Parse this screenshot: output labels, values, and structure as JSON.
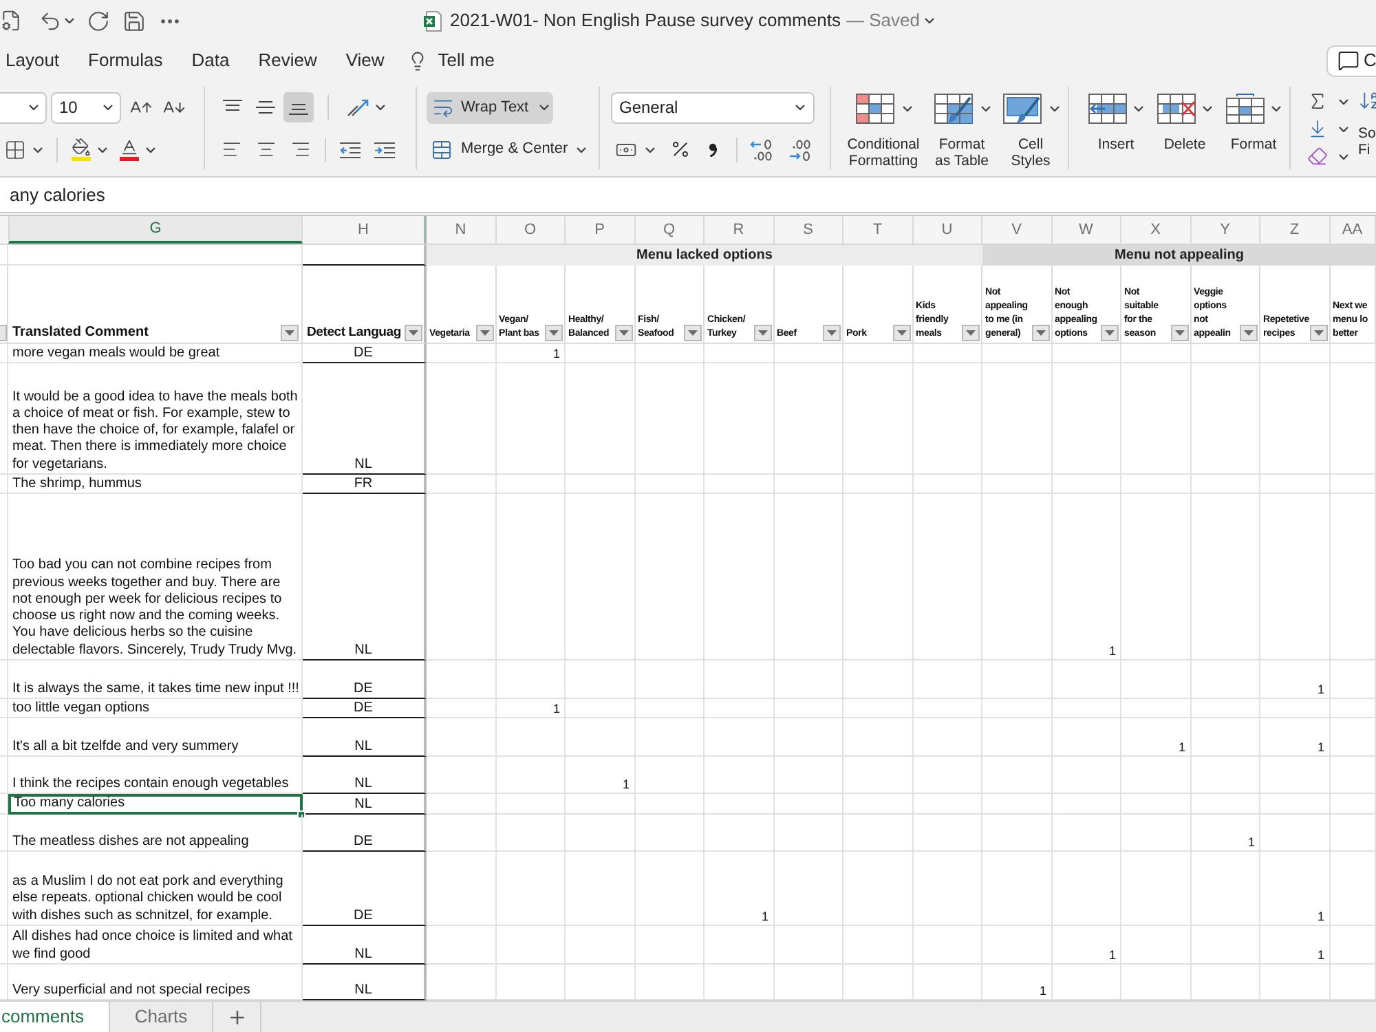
{
  "title_bar": {
    "title": "2021-W01- Non English Pause survey comments",
    "status": "— Saved"
  },
  "menu_tabs": [
    "Layout",
    "Formulas",
    "Data",
    "Review",
    "View"
  ],
  "tell_me": "Tell me",
  "comments_button": "C",
  "ribbon": {
    "font_size": "10",
    "align_vertical": [
      {
        "kind": "top",
        "selected": false
      },
      {
        "kind": "middle",
        "selected": false
      },
      {
        "kind": "bottom",
        "selected": true
      }
    ],
    "wrap_text": {
      "label": "Wrap Text",
      "on": true
    },
    "merge": "Merge & Center",
    "number_format": "General",
    "style_buttons": [
      {
        "kind": "conditional",
        "label": "Conditional Formatting"
      },
      {
        "kind": "table",
        "label": "Format as Table"
      },
      {
        "kind": "cell",
        "label": "Cell Styles"
      }
    ],
    "cell_buttons": [
      {
        "kind": "insert",
        "label": "Insert"
      },
      {
        "kind": "delete",
        "label": "Delete"
      },
      {
        "kind": "format",
        "label": "Format"
      }
    ],
    "sort_filter": "So Fi"
  },
  "formula_bar": {
    "value": "any calories"
  },
  "sheet": {
    "column_letters": [
      {
        "label": "G",
        "selected": true
      },
      {
        "label": "H",
        "selected": false
      },
      {
        "label": "N",
        "selected": false
      },
      {
        "label": "O",
        "selected": false
      },
      {
        "label": "P",
        "selected": false
      },
      {
        "label": "Q",
        "selected": false
      },
      {
        "label": "R",
        "selected": false
      },
      {
        "label": "S",
        "selected": false
      },
      {
        "label": "T",
        "selected": false
      },
      {
        "label": "U",
        "selected": false
      },
      {
        "label": "V",
        "selected": false
      },
      {
        "label": "W",
        "selected": false
      },
      {
        "label": "X",
        "selected": false
      },
      {
        "label": "Y",
        "selected": false
      },
      {
        "label": "Z",
        "selected": false
      },
      {
        "label": "AA",
        "selected": false
      }
    ],
    "comment_header": "Translated Comment",
    "language_header": "Detect Languag",
    "groups": [
      {
        "label": "Menu lacked options",
        "color": "#ececec",
        "columns": [
          "Vegetaria",
          "Vegan/ Plant bas",
          "Healthy/ Balanced",
          "Fish/ Seafood",
          "Chicken/ Turkey",
          "Beef",
          "Pork",
          "Kids friendly meals"
        ]
      },
      {
        "label": "Menu not appealing",
        "color": "#d9d9d9",
        "columns": [
          "Not appealing to me (in general)",
          "Not enough appealing options",
          "Not suitable for the season",
          "Veggie options not appealin",
          "Repetetive recipes",
          "Next we menu lo better"
        ]
      }
    ],
    "rows": [
      {
        "comment": "more vegan meals would be great",
        "language": "DE",
        "selected": false,
        "values": {
          "1": "1"
        }
      },
      {
        "comment": "It would be a good idea to have the meals both a choice of meat or fish. For example, stew to then have the choice of, for example, falafel or meat. Then there is immediately more choice for vegetarians.",
        "language": "NL",
        "selected": false,
        "values": {}
      },
      {
        "comment": "The shrimp, hummus",
        "language": "FR",
        "selected": false,
        "values": {}
      },
      {
        "comment": "Too bad you can not combine recipes from previous weeks together and buy. There are not enough per week for delicious recipes to choose us right now and the coming weeks. You have delicious herbs so the cuisine delectable flavors. Sincerely, Trudy Trudy Mvg.",
        "language": "NL",
        "selected": false,
        "values": {
          "9": "1"
        }
      },
      {
        "comment": "It is always the same, it takes time new input !!!",
        "language": "DE",
        "selected": false,
        "values": {
          "12": "1"
        }
      },
      {
        "comment": "too little vegan options",
        "language": "DE",
        "selected": false,
        "values": {
          "1": "1"
        }
      },
      {
        "comment": "It's all a bit tzelfde and very summery",
        "language": "NL",
        "selected": false,
        "values": {
          "10": "1",
          "12": "1"
        }
      },
      {
        "comment": "I think the recipes contain enough vegetables",
        "language": "NL",
        "selected": false,
        "values": {
          "2": "1"
        }
      },
      {
        "comment": "Too many calories",
        "language": "NL",
        "selected": true,
        "values": {}
      },
      {
        "comment": "The meatless dishes are not appealing",
        "language": "DE",
        "selected": false,
        "values": {
          "11": "1"
        }
      },
      {
        "comment": "as a Muslim I do not eat pork and everything else repeats. optional chicken would be cool with dishes such as schnitzel, for example.",
        "language": "DE",
        "selected": false,
        "values": {
          "4": "1",
          "12": "1"
        }
      },
      {
        "comment": "All dishes had once choice is limited and what we find good",
        "language": "NL",
        "selected": false,
        "values": {
          "9": "1",
          "12": "1"
        }
      },
      {
        "comment": "Very superficial and not special recipes",
        "language": "NL",
        "selected": false,
        "values": {
          "8": "1"
        }
      }
    ]
  },
  "sheet_tabs": [
    {
      "label": "comments",
      "selected": true
    },
    {
      "label": "Charts",
      "selected": false
    }
  ]
}
